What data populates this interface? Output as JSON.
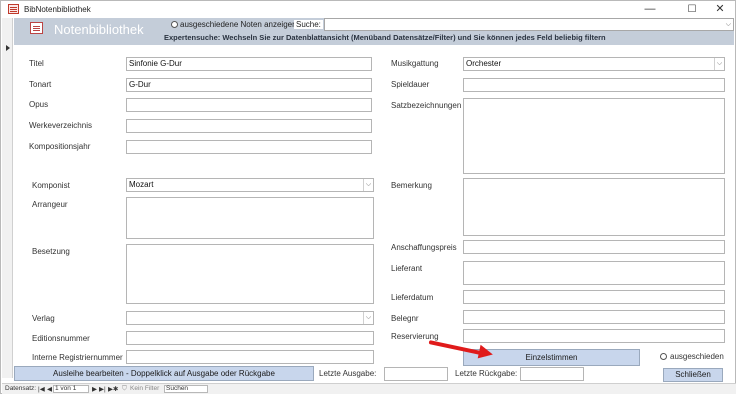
{
  "window": {
    "title": "BibNotenbibliothek",
    "controls": {
      "minimize": "—",
      "maximize": "☐",
      "close": "✕"
    }
  },
  "header": {
    "title": "Notenbibliothek",
    "radio_label": "ausgeschiedene Noten anzeigen",
    "search_label": "Suche:",
    "search_value": "",
    "hint": "Expertensuche: Wechseln Sie zur Datenblattansicht (Menüband Datensätze/Filter) und Sie können jedes Feld beliebig filtern"
  },
  "form": {
    "titel_label": "Titel",
    "titel_value": "Sinfonie G-Dur",
    "tonart_label": "Tonart",
    "tonart_value": "G-Dur",
    "opus_label": "Opus",
    "opus_value": "",
    "werkeverzeichnis_label": "Werkeverzeichnis",
    "werkeverzeichnis_value": "",
    "kompositionsjahr_label": "Kompositionsjahr",
    "kompositionsjahr_value": "",
    "komponist_label": "Komponist",
    "komponist_value": "Mozart",
    "arrangeur_label": "Arrangeur",
    "arrangeur_value": "",
    "besetzung_label": "Besetzung",
    "besetzung_value": "",
    "verlag_label": "Verlag",
    "verlag_value": "",
    "editionsnummer_label": "Editionsnummer",
    "editionsnummer_value": "",
    "registriernummer_label": "Interne Registriernummer",
    "registriernummer_value": "",
    "musikgattung_label": "Musikgattung",
    "musikgattung_value": "Orchester",
    "spieldauer_label": "Spieldauer",
    "spieldauer_value": "",
    "satzbezeichnungen_label": "Satzbezeichnungen",
    "satzbezeichnungen_value": "",
    "bemerkung_label": "Bemerkung",
    "bemerkung_value": "",
    "anschaffungspreis_label": "Anschaffungspreis",
    "anschaffungspreis_value": "",
    "lieferant_label": "Lieferant",
    "lieferant_value": "",
    "lieferdatum_label": "Lieferdatum",
    "lieferdatum_value": "",
    "belegnr_label": "Belegnr",
    "belegnr_value": "",
    "reservierung_label": "Reservierung",
    "reservierung_value": ""
  },
  "buttons": {
    "einzelstimmen": "Einzelstimmen",
    "ausgeschieden_label": "ausgeschieden",
    "ausleihe": "Ausleihe bearbeiten - Doppelklick auf Ausgabe oder Rückgabe",
    "schliessen": "Schließen"
  },
  "loan": {
    "letzte_ausgabe_label": "Letzte Ausgabe:",
    "letzte_ausgabe_value": "",
    "letzte_rueckgabe_label": "Letzte Rückgabe:",
    "letzte_rueckgabe_value": ""
  },
  "navbar": {
    "label": "Datensatz:",
    "first": "|◀",
    "prev": "◀",
    "position": "1 von 1",
    "next": "▶",
    "last": "▶|",
    "new": "▶✱",
    "filter": "Kein Filter",
    "search": "Suchen"
  },
  "colors": {
    "header_bg": "#c4cdd9",
    "button_bg": "#c8d6ec",
    "annotation_arrow": "#e01b1b"
  }
}
